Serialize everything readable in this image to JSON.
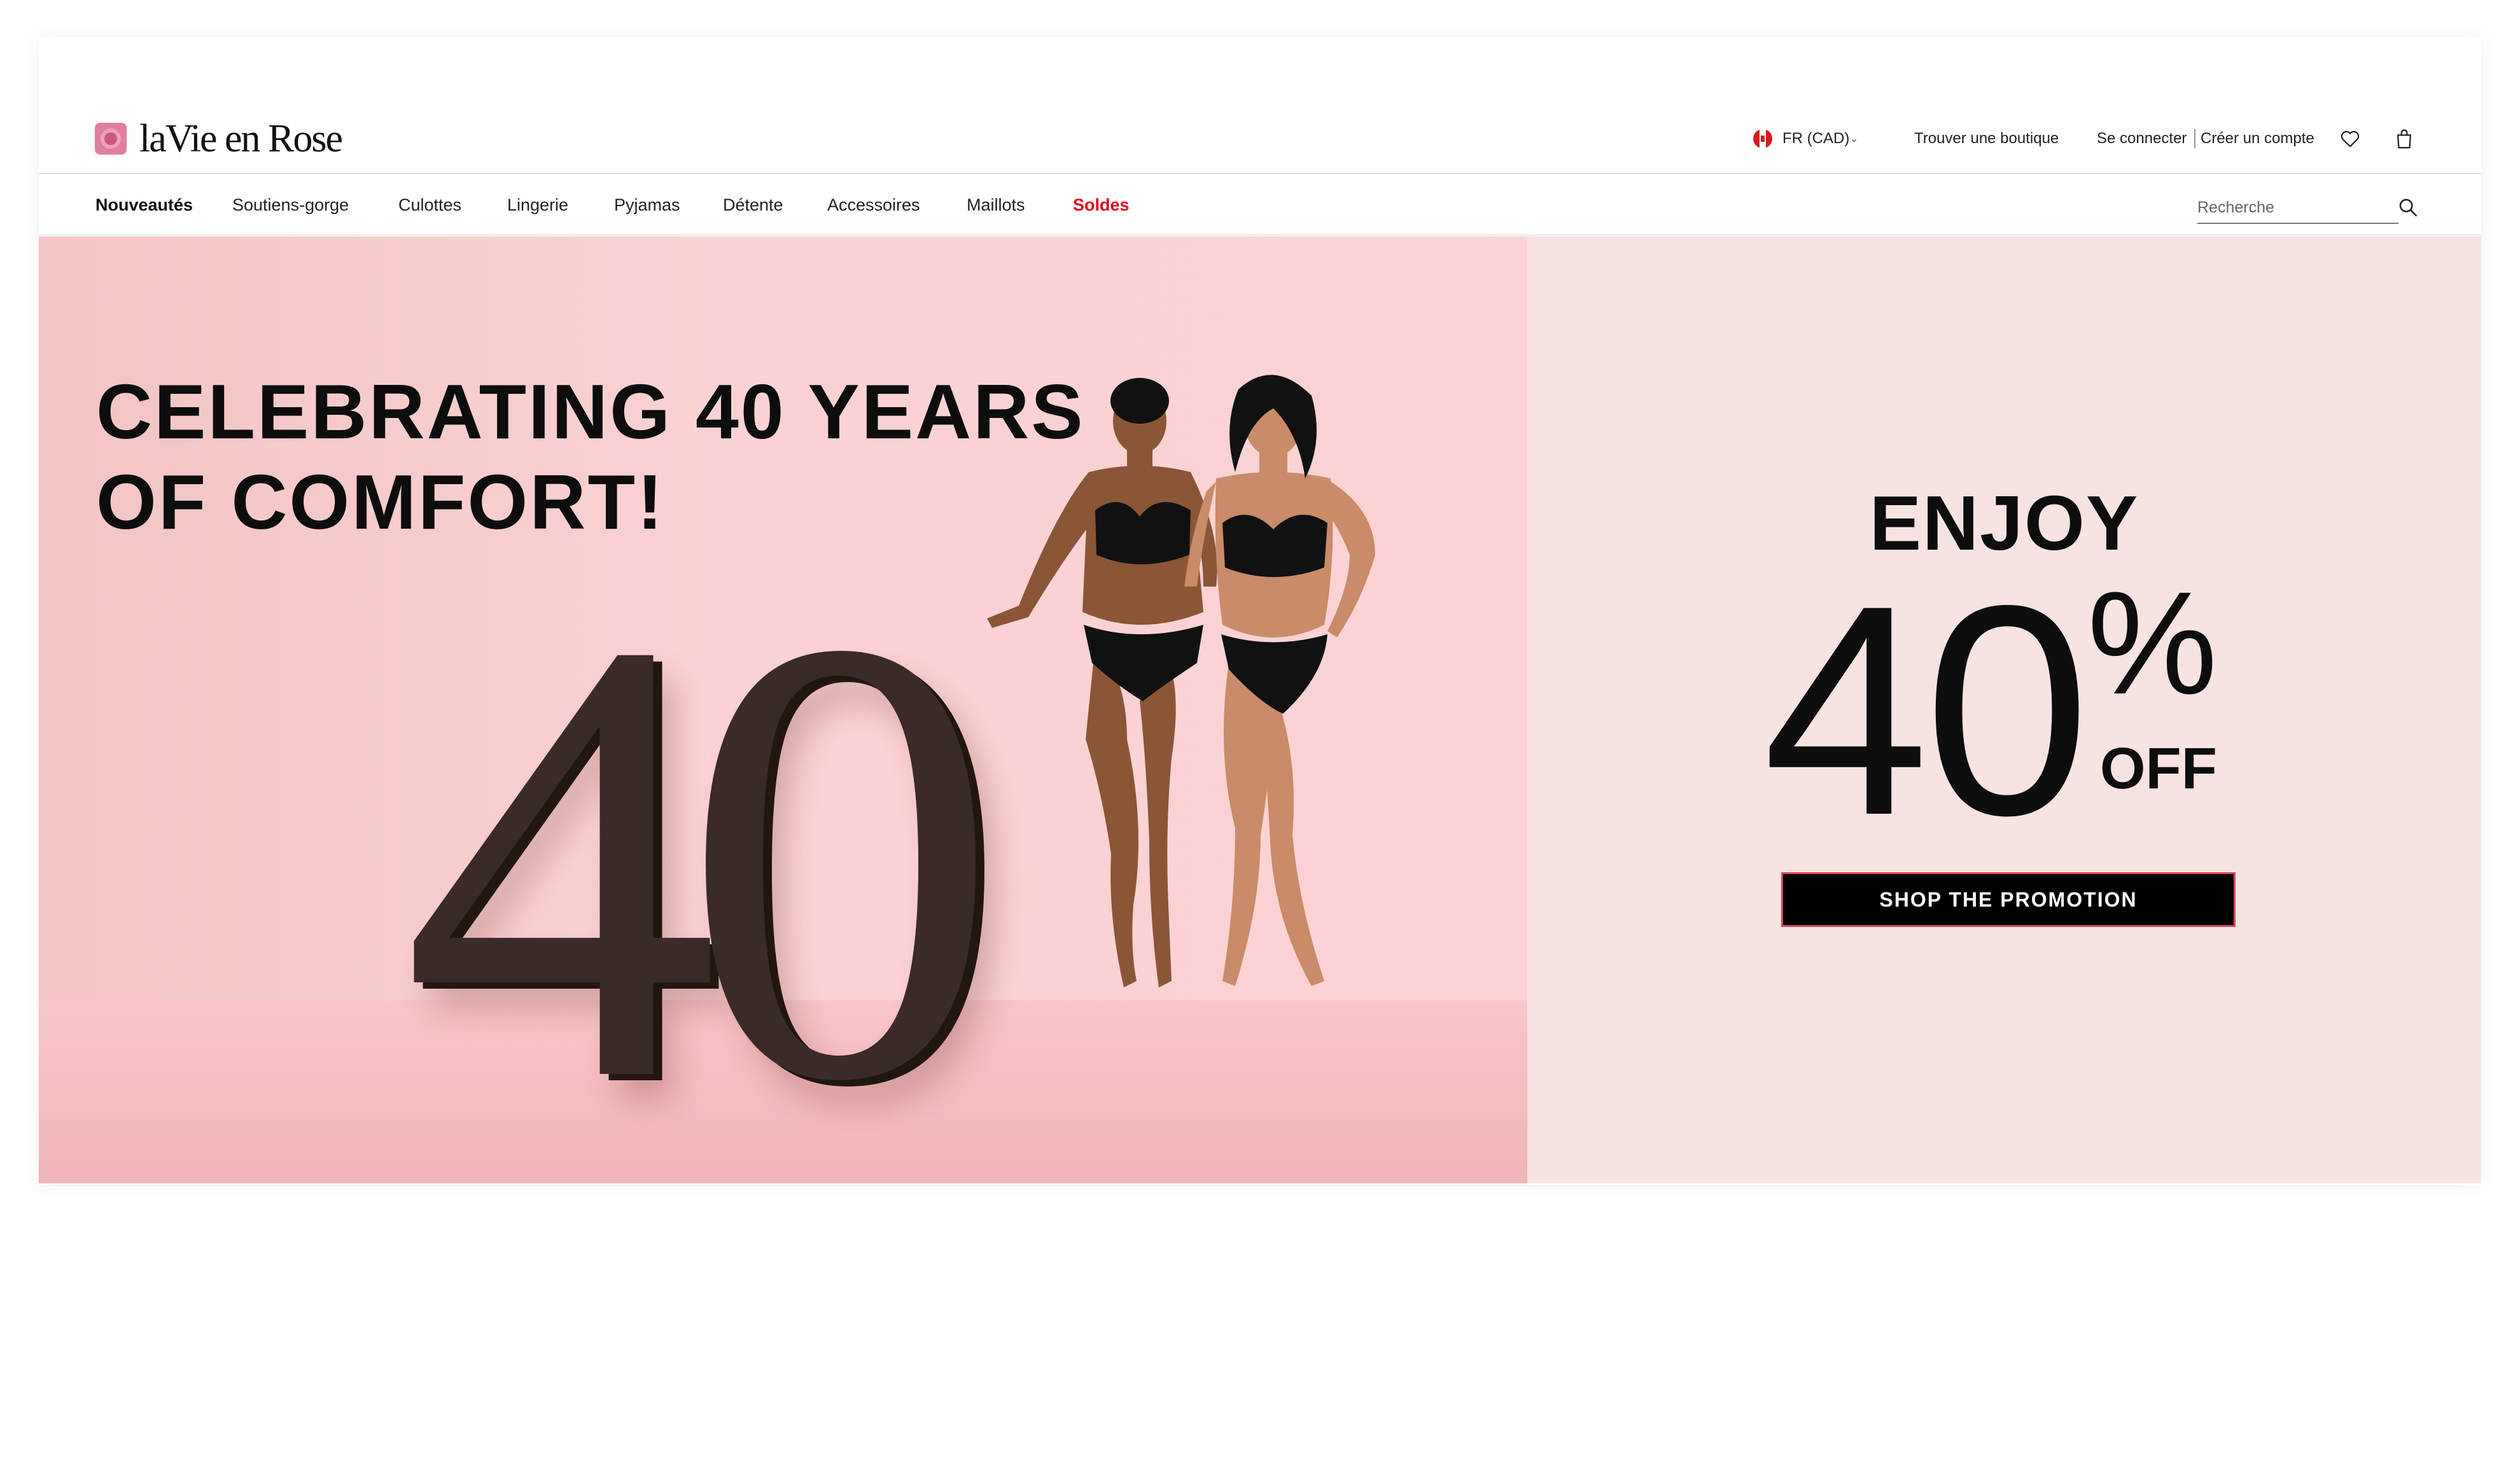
{
  "brand": {
    "name": "laVie en Rose",
    "accent": "#e3051b"
  },
  "header": {
    "locale": "FR (CAD)",
    "store_link": "Trouver une boutique",
    "login_link": "Se connecter",
    "signup_link": "Créer un compte"
  },
  "nav": {
    "items": [
      {
        "label": "Nouveautés",
        "state": "active"
      },
      {
        "label": "Soutiens-gorge"
      },
      {
        "label": "Culottes"
      },
      {
        "label": "Lingerie"
      },
      {
        "label": "Pyjamas"
      },
      {
        "label": "Détente"
      },
      {
        "label": "Accessoires"
      },
      {
        "label": "Maillots"
      },
      {
        "label": "Soldes",
        "state": "sale"
      }
    ],
    "search_placeholder": "Recherche"
  },
  "hero": {
    "headline_line1": "CELEBRATING 40 YEARS",
    "headline_line2": "OF COMFORT!",
    "big_number": "40",
    "image": "two smiling models in black bras and briefs beside a giant dark-brown \"40\" on a pink set"
  },
  "promo": {
    "enjoy": "ENJOY",
    "number": "40",
    "percent": "%",
    "off": "OFF",
    "cta": "SHOP THE PROMOTION",
    "background": "#f8e3e3"
  },
  "icons": [
    "canada-flag-icon",
    "chevron-down-icon",
    "heart-icon",
    "shopping-bag-icon",
    "search-icon",
    "rose-logo-icon"
  ]
}
